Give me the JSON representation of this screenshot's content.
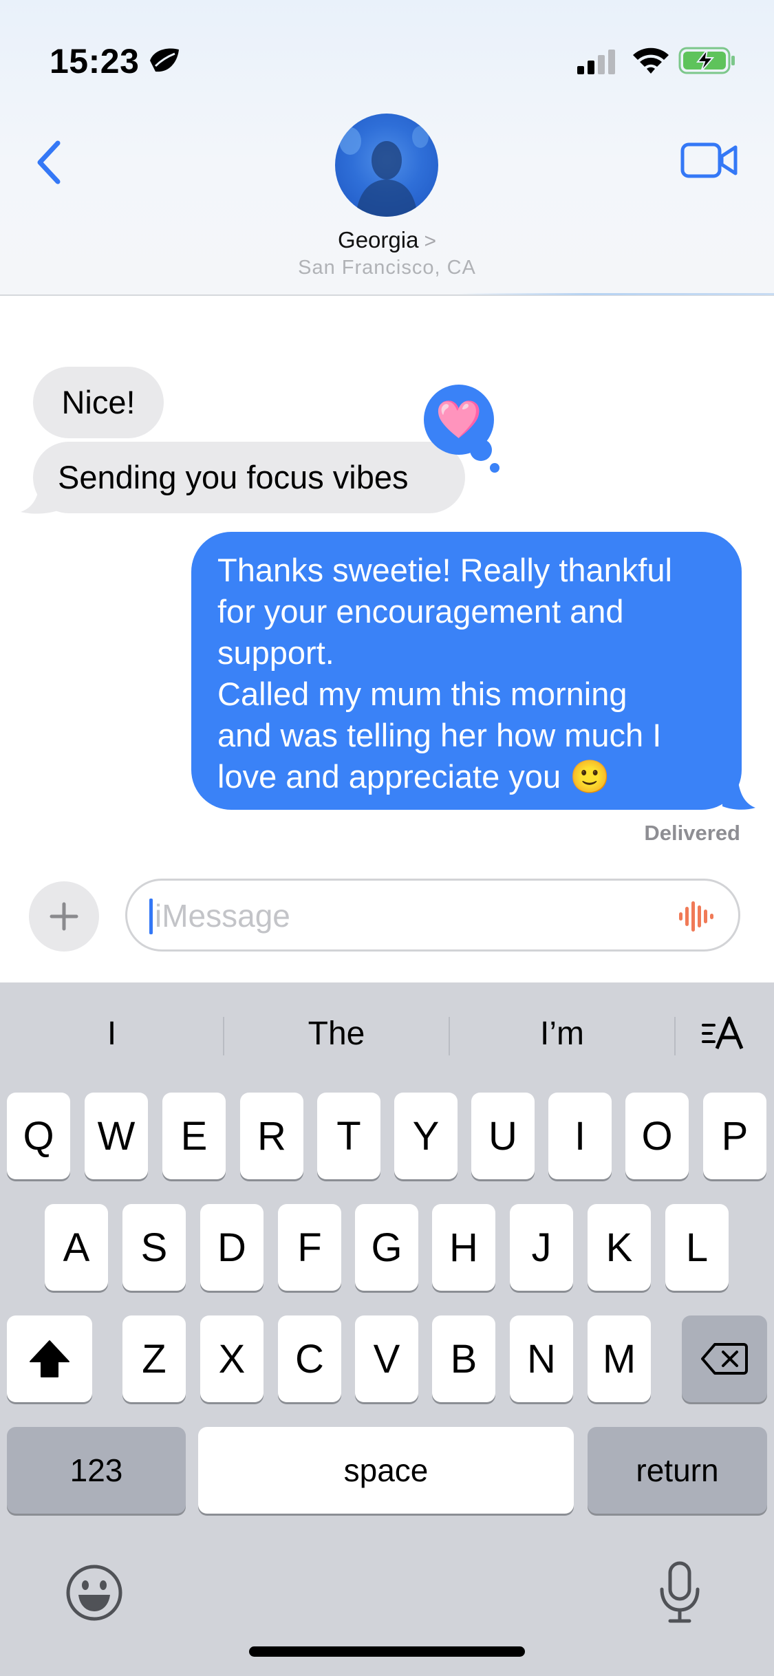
{
  "status_bar": {
    "time": "15:23"
  },
  "header": {
    "contact_name": "Georgia",
    "chevron": ">",
    "location": "San Francisco, CA"
  },
  "messages": {
    "incoming": [
      "Nice!",
      "Sending you focus vibes"
    ],
    "outgoing_lines": [
      "Thanks sweetie! Really thankful",
      "for your encouragement and",
      "support.",
      "Called my mum this morning",
      "and was telling her how much I",
      "love and appreciate you 🙂"
    ],
    "delivered_label": "Delivered",
    "tapback": "🩷"
  },
  "compose": {
    "placeholder": "iMessage",
    "plus": "+"
  },
  "keyboard": {
    "predictions": [
      "I",
      "The",
      "I’m"
    ],
    "row1": [
      "Q",
      "W",
      "E",
      "R",
      "T",
      "Y",
      "U",
      "I",
      "O",
      "P"
    ],
    "row2": [
      "A",
      "S",
      "D",
      "F",
      "G",
      "H",
      "J",
      "K",
      "L"
    ],
    "row3": [
      "Z",
      "X",
      "C",
      "V",
      "B",
      "N",
      "M"
    ],
    "numbers_label": "123",
    "space_label": "space",
    "return_label": "return"
  },
  "colors": {
    "accent": "#3a82f7",
    "incoming_bubble": "#e9e9eb",
    "keyboard_bg": "#d1d3d9",
    "dark_key": "#acb0ba"
  }
}
